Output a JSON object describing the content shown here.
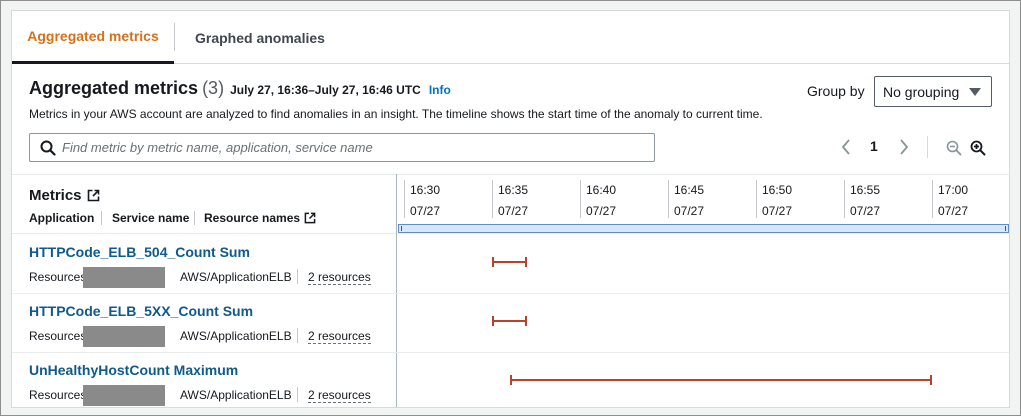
{
  "tabs": [
    {
      "label": "Aggregated metrics",
      "active": true
    },
    {
      "label": "Graphed anomalies",
      "active": false
    }
  ],
  "header": {
    "title": "Aggregated metrics",
    "count": "(3)",
    "time_range": "July 27, 16:36–July 27, 16:46 UTC",
    "info_label": "Info",
    "description": "Metrics in your AWS account are analyzed to find anomalies in an insight. The timeline shows the start time of the anomaly to current time."
  },
  "group_by": {
    "label": "Group by",
    "selected": "No grouping"
  },
  "search": {
    "placeholder": "Find metric by metric name, application, service name",
    "value": ""
  },
  "pagination": {
    "current_page": "1"
  },
  "table": {
    "metrics_header": "Metrics",
    "subheaders": [
      "Application",
      "Service name",
      "Resource names"
    ],
    "timeline_ticks": [
      {
        "time": "16:30",
        "date": "07/27"
      },
      {
        "time": "16:35",
        "date": "07/27"
      },
      {
        "time": "16:40",
        "date": "07/27"
      },
      {
        "time": "16:45",
        "date": "07/27"
      },
      {
        "time": "16:50",
        "date": "07/27"
      },
      {
        "time": "16:55",
        "date": "07/27"
      },
      {
        "time": "17:00",
        "date": "07/27"
      }
    ],
    "rows": [
      {
        "metric": "HTTPCode_ELB_504_Count Sum",
        "resources_label": "Resources",
        "service": "AWS/ApplicationELB",
        "resources_link": "2 resources",
        "anomaly_start_min": 5.0,
        "anomaly_end_min": 7.0
      },
      {
        "metric": "HTTPCode_ELB_5XX_Count Sum",
        "resources_label": "Resources",
        "service": "AWS/ApplicationELB",
        "resources_link": "2 resources",
        "anomaly_start_min": 5.0,
        "anomaly_end_min": 7.0
      },
      {
        "metric": "UnHealthyHostCount Maximum",
        "resources_label": "Resources",
        "service": "AWS/ApplicationELB",
        "resources_link": "2 resources",
        "anomaly_start_min": 6.0,
        "anomaly_end_min": 30.0
      }
    ]
  },
  "colors": {
    "accent_tab": "#d5711b",
    "link": "#0e5a8a",
    "anomaly_bar": "#b8422c"
  }
}
